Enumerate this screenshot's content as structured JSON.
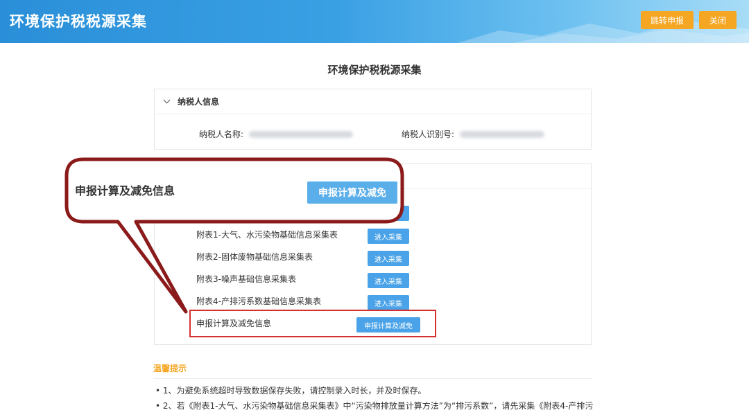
{
  "header": {
    "app_title": "环境保护税税源采集",
    "jump_label": "跳转申报",
    "close_label": "关闭"
  },
  "page_title": "环境保护税税源采集",
  "taxpayer_panel": {
    "title": "纳税人信息",
    "name_label": "纳税人名称:",
    "id_label": "纳税人识别号:"
  },
  "forms": [
    {
      "label": "附表1-大气、水污染物基础信息采集表",
      "button": "进入采集"
    },
    {
      "label": "附表2-固体废物基础信息采集表",
      "button": "进入采集"
    },
    {
      "label": "附表3-噪声基础信息采集表",
      "button": "进入采集"
    },
    {
      "label": "附表4-产排污系数基础信息采集表",
      "button": "进入采集"
    }
  ],
  "calc_row": {
    "label": "申报计算及减免信息",
    "button": "申报计算及减免"
  },
  "callout": {
    "label": "申报计算及减免信息",
    "button": "申报计算及减免"
  },
  "tips": {
    "title": "温馨提示",
    "items": [
      "1、为避免系统超时导致数据保存失败，请控制录入时长，并及时保存。",
      "2、若《附表1-大气、水污染物基础信息采集表》中“污染物排放量计算方法”为“排污系数”，请先采集《附表4-产排污"
    ]
  },
  "colors": {
    "header_blue": "#2a8fd8",
    "orange": "#f5a623",
    "button_blue": "#4aa3e8",
    "callout_red": "#8b1a1a",
    "highlight_red": "#d43030"
  }
}
